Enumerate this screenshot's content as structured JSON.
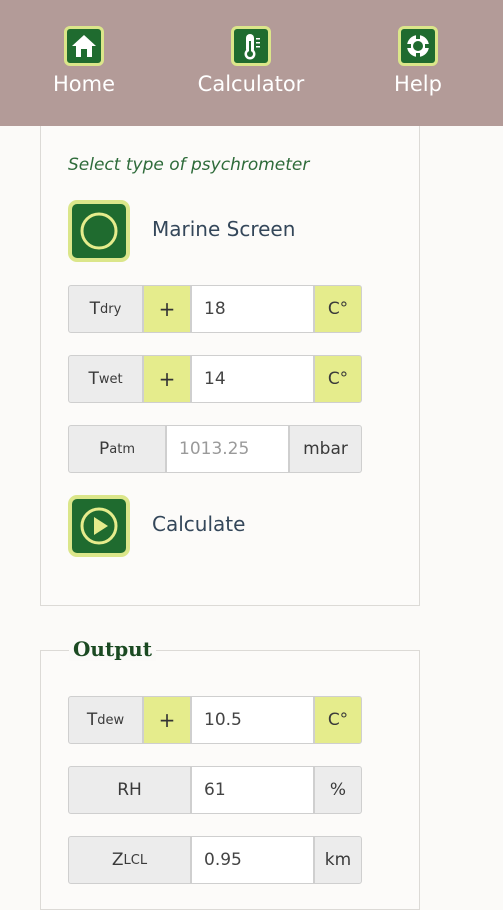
{
  "nav": {
    "items": [
      {
        "label": "Home",
        "icon": "home-icon"
      },
      {
        "label": "Calculator",
        "icon": "thermometer-icon"
      },
      {
        "label": "Help",
        "icon": "lifebuoy-icon"
      }
    ],
    "bar_color": "#b39b98"
  },
  "input": {
    "prompt": "Select type of psychrometer",
    "psychrometer_label": "Marine Screen",
    "tdry": {
      "sym": "T",
      "sub": "dry",
      "plus": "+",
      "value": "18",
      "unit": "C°"
    },
    "twet": {
      "sym": "T",
      "sub": "wet",
      "plus": "+",
      "value": "14",
      "unit": "C°"
    },
    "patm": {
      "sym": "P",
      "sub": "atm",
      "placeholder": "1013.25",
      "unit": "mbar"
    },
    "calculate_label": "Calculate"
  },
  "output": {
    "legend": "Output",
    "tdew": {
      "sym": "T",
      "sub": "dew",
      "plus": "+",
      "value": "10.5",
      "unit": "C°"
    },
    "rh": {
      "label": "RH",
      "value": "61",
      "unit": "%"
    },
    "zlcl": {
      "sym": "Z",
      "sub": "LCL",
      "value": "0.95",
      "unit": "km"
    }
  },
  "colors": {
    "accent_green": "#1f6b2f",
    "accent_yellow": "#e5ec8c"
  }
}
